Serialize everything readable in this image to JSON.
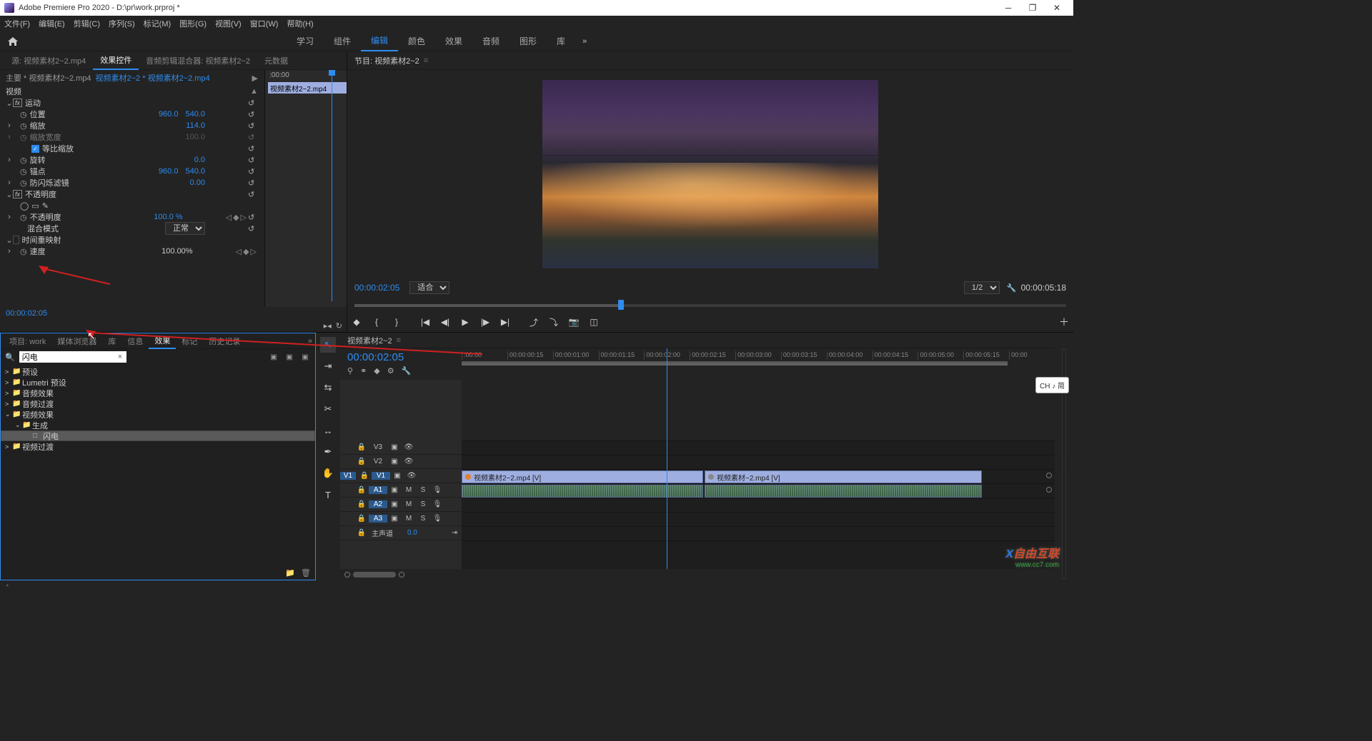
{
  "title": "Adobe Premiere Pro 2020 - D:\\pr\\work.prproj *",
  "menus": [
    "文件(F)",
    "编辑(E)",
    "剪辑(C)",
    "序列(S)",
    "标记(M)",
    "图形(G)",
    "视图(V)",
    "窗口(W)",
    "帮助(H)"
  ],
  "workspaces": [
    "学习",
    "组件",
    "编辑",
    "颜色",
    "效果",
    "音频",
    "图形",
    "库"
  ],
  "ws_active": "编辑",
  "source_tabs": {
    "src": "源: 视频素材2~2.mp4",
    "ec": "效果控件",
    "mixer": "音频剪辑混合器: 视频素材2~2",
    "meta": "元数据"
  },
  "ec": {
    "breadcrumb_main": "主要 * 视频素材2~2.mp4",
    "breadcrumb_sub": "视频素材2~2 * 视频素材2~2.mp4",
    "clip_label": "视频素材2~2.mp4",
    "time_header": ":00:00",
    "section_video": "视频",
    "motion": "运动",
    "position": "位置",
    "pos_x": "960.0",
    "pos_y": "540.0",
    "scale": "缩放",
    "scale_v": "114.0",
    "scale_w": "缩放宽度",
    "scale_w_v": "100.0",
    "uniform": "等比缩放",
    "rotation": "旋转",
    "rotation_v": "0.0",
    "anchor": "锚点",
    "anchor_x": "960.0",
    "anchor_y": "540.0",
    "flicker": "防闪烁滤镜",
    "flicker_v": "0.00",
    "opacity": "不透明度",
    "opacity_prop": "不透明度",
    "opacity_v": "100.0 %",
    "blend": "混合模式",
    "blend_v": "正常",
    "remap": "时间重映射",
    "speed": "速度",
    "speed_v": "100.00%",
    "timecode": "00:00:02:05"
  },
  "program": {
    "title": "节目: 视频素材2~2",
    "tc_left": "00:00:02:05",
    "fit": "适合",
    "scale": "1/2",
    "tc_right": "00:00:05:18"
  },
  "proj": {
    "tabs": {
      "proj": "项目: work",
      "media": "媒体浏览器",
      "lib": "库",
      "info": "信息",
      "fx": "效果",
      "marker": "标记",
      "hist": "历史记录"
    },
    "search": "闪电",
    "tree": [
      {
        "ind": 0,
        "open": ">",
        "icn": "📁",
        "label": "预设"
      },
      {
        "ind": 0,
        "open": ">",
        "icn": "📁",
        "label": "Lumetri 预设"
      },
      {
        "ind": 0,
        "open": ">",
        "icn": "📁",
        "label": "音频效果"
      },
      {
        "ind": 0,
        "open": ">",
        "icn": "📁",
        "label": "音频过渡"
      },
      {
        "ind": 0,
        "open": "⌄",
        "icn": "📁",
        "label": "视频效果"
      },
      {
        "ind": 1,
        "open": "⌄",
        "icn": "📁",
        "label": "生成"
      },
      {
        "ind": 2,
        "open": "",
        "icn": "□",
        "label": "闪电",
        "sel": true
      },
      {
        "ind": 0,
        "open": ">",
        "icn": "📁",
        "label": "视频过渡"
      }
    ]
  },
  "timeline": {
    "seq": "视频素材2~2",
    "tc": "00:00:02:05",
    "ruler": [
      ":00:00",
      "00:00:00:15",
      "00:00:01:00",
      "00:00:01:15",
      "00:00:02:00",
      "00:00:02:15",
      "00:00:03:00",
      "00:00:03:15",
      "00:00:04:00",
      "00:00:04:15",
      "00:00:05:00",
      "00:00:05:15",
      "00:00"
    ],
    "tracks_v": [
      "V3",
      "V2",
      "V1"
    ],
    "tracks_a": [
      "A1",
      "A2",
      "A3"
    ],
    "master": "主声道",
    "master_v": "0.0",
    "clip1": "视频素材2~2.mp4 [V]",
    "clip2": "视频素材~2.mp4 [V]"
  },
  "ime": "CH ♪ 简",
  "watermark": "自由互联",
  "watermark_url": "www.cc7.com"
}
